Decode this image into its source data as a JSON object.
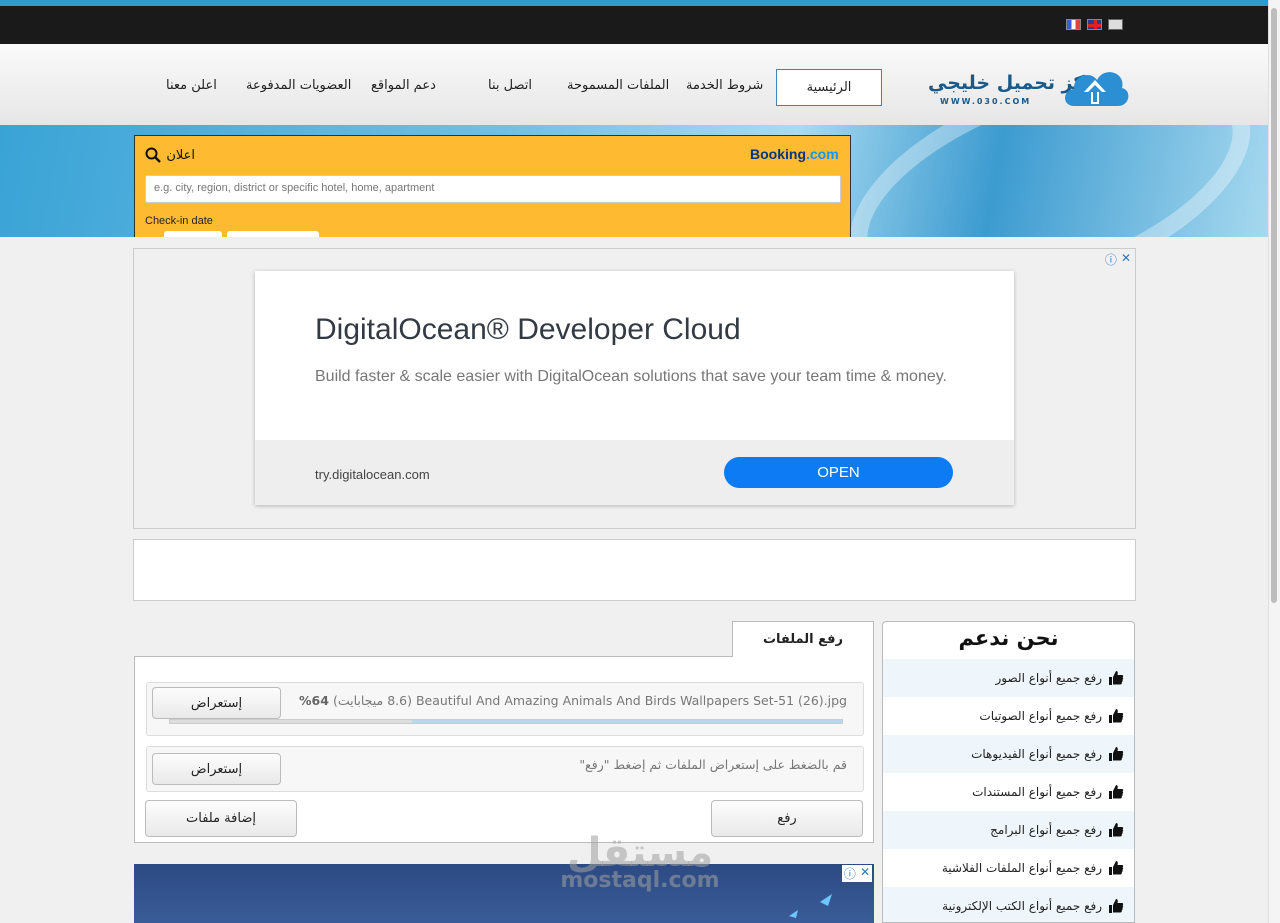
{
  "header": {
    "flags": [
      "fr-flag-icon",
      "uk-flag-icon",
      "ar-flag-icon"
    ]
  },
  "logo": {
    "title": "مركز تحميل خليجي",
    "subtitle": "WWW.030.COM"
  },
  "nav": {
    "home": "الرئيسية",
    "items": [
      "شروط الخدمة",
      "الملفات المسموحة",
      "اتصل بنا",
      "دعم المواقع",
      "العضويات المدفوعة",
      "اعلن معنا"
    ]
  },
  "booking_ad": {
    "ad_label": "اعلان",
    "logo_main": "Booking",
    "logo_suffix": ".com",
    "placeholder": "e.g. city, region, district or specific hotel, home, apartment",
    "checkin_label": "Check-in date"
  },
  "do_ad": {
    "title": "DigitalOcean® Developer Cloud",
    "description": "Build faster & scale easier with DigitalOcean solutions that save your team time & money.",
    "url": "try.digitalocean.com",
    "cta": "OPEN"
  },
  "upload": {
    "tab_label": "رفع الملفات",
    "file": {
      "name": "Beautiful And Amazing Animals And Birds Wallpapers Set-51 (26).jpg",
      "size": "(8.6 ميجابايت)",
      "percent_label": "64%",
      "progress": 0.64
    },
    "hint": "قم بالضغط على إستعراض الملفات ثم إضغط \"رفع\"",
    "browse_label": "إستعراض",
    "upload_label": "رفع",
    "add_files_label": "إضافة ملفات"
  },
  "support": {
    "title": "نحن ندعم",
    "items": [
      "رفع جميع أنواع الصور",
      "رفع جميع أنواع الصوتيات",
      "رفع جميع أنواع الفيديوهات",
      "رفع جميع أنواع المستندات",
      "رفع جميع أنواع البرامج",
      "رفع جميع أنواع الملفات الفلاشية",
      "رفع جميع أنواع الكتب الإلكترونية"
    ]
  },
  "watermark": {
    "arabic": "مستقل",
    "latin": "mostaql.com"
  },
  "colors": {
    "accent": "#2e9bd0",
    "booking_bg": "#febb32",
    "do_button": "#0d7bf3"
  }
}
